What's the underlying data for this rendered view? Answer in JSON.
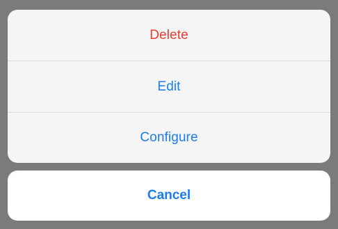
{
  "action_sheet": {
    "actions": [
      {
        "label": "Delete",
        "style": "destructive",
        "color": "#f23b30"
      },
      {
        "label": "Edit",
        "style": "default",
        "color": "#1d7cf2"
      },
      {
        "label": "Configure",
        "style": "default",
        "color": "#1d7cf2"
      }
    ],
    "cancel_label": "Cancel"
  },
  "colors": {
    "backdrop": "#7b7b7b",
    "sheet_background": "#f5f5f5",
    "cancel_background": "#ffffff",
    "accent": "#1d7cf2",
    "destructive": "#f23b30",
    "divider": "#d9d9dd"
  }
}
